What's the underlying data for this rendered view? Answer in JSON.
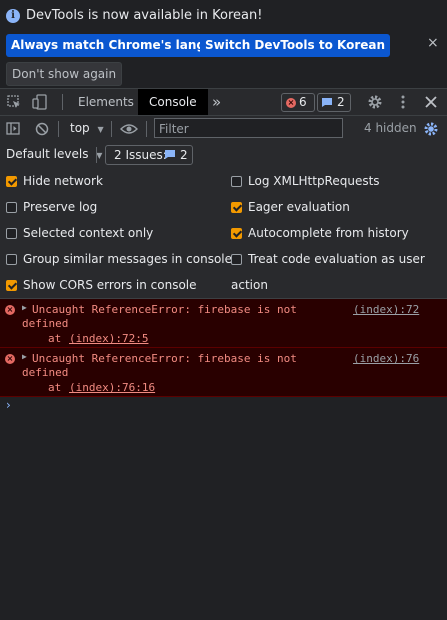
{
  "banner": {
    "text": "DevTools is now available in Korean!",
    "buttons": {
      "always_match": "Always match Chrome's language",
      "switch_korean": "Switch DevTools to Korean",
      "dont_show": "Don't show again"
    },
    "close_glyph": "×",
    "info_glyph": "i"
  },
  "tabs": {
    "elements": "Elements",
    "console": "Console",
    "more_glyph": "»",
    "errors_count": "6",
    "messages_count": "2"
  },
  "toolbar": {
    "context": "top",
    "filter_placeholder": "Filter",
    "hidden_count": "4 hidden"
  },
  "levels": {
    "default_levels": "Default levels",
    "issues_label": "2 Issues:",
    "issues_count": "2"
  },
  "settings": {
    "left": [
      {
        "label": "Hide network",
        "checked": true
      },
      {
        "label": "Preserve log",
        "checked": false
      },
      {
        "label": "Selected context only",
        "checked": false
      },
      {
        "label": "Group similar messages in console",
        "checked": false
      },
      {
        "label": "Show CORS errors in console",
        "checked": true
      }
    ],
    "right": [
      {
        "label": "Log XMLHttpRequests",
        "checked": false
      },
      {
        "label": "Eager evaluation",
        "checked": true
      },
      {
        "label": "Autocomplete from history",
        "checked": true
      },
      {
        "label": "Treat code evaluation as user action",
        "checked": false
      }
    ]
  },
  "messages": [
    {
      "text_line1": "Uncaught ReferenceError: firebase is not",
      "text_line2": "defined",
      "at": "at",
      "trace_link": "(index):72:5",
      "source": "(index):72"
    },
    {
      "text_line1": "Uncaught ReferenceError: firebase is not",
      "text_line2": "defined",
      "at": "at",
      "trace_link": "(index):76:16",
      "source": "(index):76"
    }
  ],
  "prompt_glyph": "›",
  "colors": {
    "accent_blue": "#0b57d0",
    "checkbox_orange": "#f29900",
    "error_bg": "#290000",
    "error_text": "#f28b82"
  }
}
